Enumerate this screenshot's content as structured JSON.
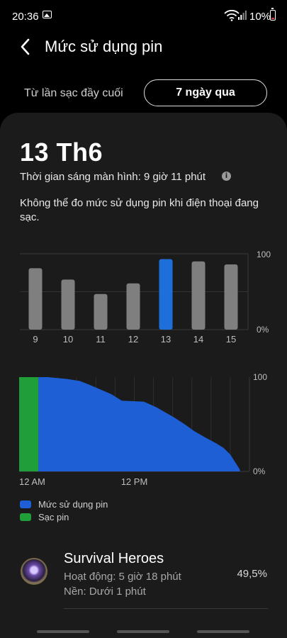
{
  "status_bar": {
    "time": "20:36",
    "battery_percent": "10%",
    "icons": [
      "image-icon",
      "wifi-icon",
      "signal-icon",
      "battery-icon"
    ]
  },
  "header": {
    "title": "Mức sử dụng pin"
  },
  "range": {
    "label": "Từ lần sạc đầy cuối",
    "selected": "7 ngày qua"
  },
  "summary": {
    "date": "13 Th6",
    "screen_time": "Thời gian sáng màn hình: 9 giờ 11 phút",
    "note": "Không thể đo mức sử dụng pin khi điện thoại đang sạc."
  },
  "colors": {
    "accent": "#1e6fd9",
    "inactive_bar": "#7f7f7f",
    "charging": "#1f9e3a",
    "usage": "#1e5fd6"
  },
  "chart_data": [
    {
      "type": "bar",
      "categories": [
        "9",
        "10",
        "11",
        "12",
        "13",
        "14",
        "15"
      ],
      "values": [
        81,
        66,
        47,
        61,
        93,
        90,
        86
      ],
      "selected_index": 4,
      "ylim": [
        0,
        100
      ],
      "y_tick_labels": [
        "100",
        "0%"
      ]
    },
    {
      "type": "area",
      "x_tick_labels": [
        "12 AM",
        "12 PM"
      ],
      "y_tick_labels": [
        "100",
        "0%"
      ],
      "ylim": [
        0,
        100
      ],
      "x_hours": [
        0,
        2,
        4,
        6,
        8,
        10,
        12,
        14,
        16,
        18,
        20,
        22,
        24
      ],
      "series": [
        {
          "name": "Mức sử dụng pin",
          "x": [
            2.0,
            3.0,
            5.0,
            6.3,
            7.3,
            9.6,
            10.7,
            13.0,
            14.3,
            16.2,
            17.4,
            18.2,
            19.4,
            20.5,
            21.3,
            22.0,
            23.0
          ],
          "values": [
            100,
            100,
            98,
            96,
            92,
            82,
            75,
            74,
            68,
            57,
            49,
            43,
            36,
            30,
            25,
            18,
            2
          ]
        },
        {
          "name": "Sạc pin",
          "x": [
            0,
            2.0
          ],
          "values": [
            100,
            100
          ]
        }
      ]
    }
  ],
  "legend": [
    {
      "label": "Mức sử dụng pin",
      "color": "#1e5fd6"
    },
    {
      "label": "Sạc pin",
      "color": "#1f9e3a"
    }
  ],
  "apps": [
    {
      "name": "Survival Heroes",
      "active": "Hoạt động: 5 giờ 18 phút",
      "background": "Nền: Dưới 1 phút",
      "percent": "49,5%",
      "icon": "game-app-icon"
    }
  ]
}
